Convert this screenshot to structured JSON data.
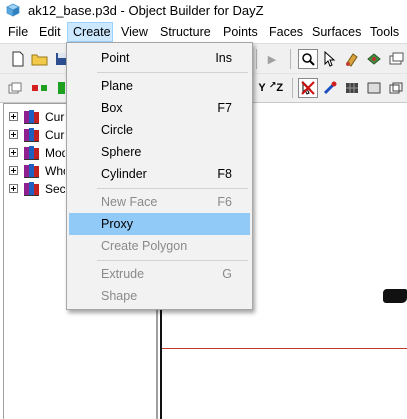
{
  "window": {
    "title": "ak12_base.p3d - Object Builder for DayZ",
    "icon": "cube-icon"
  },
  "menubar": {
    "items": [
      {
        "label": "File"
      },
      {
        "label": "Edit"
      },
      {
        "label": "Create",
        "active": true
      },
      {
        "label": "View"
      },
      {
        "label": "Structure"
      },
      {
        "label": "Points"
      },
      {
        "label": "Faces"
      },
      {
        "label": "Surfaces"
      },
      {
        "label": "Tools"
      }
    ]
  },
  "create_menu": {
    "items": [
      {
        "label": "Point",
        "shortcut": "Ins",
        "enabled": true
      },
      {
        "label": "Plane",
        "shortcut": "",
        "enabled": true
      },
      {
        "label": "Box",
        "shortcut": "F7",
        "enabled": true
      },
      {
        "label": "Circle",
        "shortcut": "",
        "enabled": true
      },
      {
        "label": "Sphere",
        "shortcut": "",
        "enabled": true
      },
      {
        "label": "Cylinder",
        "shortcut": "F8",
        "enabled": true
      },
      {
        "label": "New Face",
        "shortcut": "F6",
        "enabled": false
      },
      {
        "label": "Proxy",
        "shortcut": "",
        "enabled": true,
        "highlighted": true
      },
      {
        "label": "Create Polygon",
        "shortcut": "",
        "enabled": false
      },
      {
        "label": "Extrude",
        "shortcut": "G",
        "enabled": false
      },
      {
        "label": "Shape",
        "shortcut": "",
        "enabled": false
      }
    ]
  },
  "tree": {
    "items": [
      {
        "label": "Curr"
      },
      {
        "label": "Curr"
      },
      {
        "label": "Mode"
      },
      {
        "label": "Who"
      },
      {
        "label": "Secti"
      }
    ]
  },
  "colors": {
    "menu_highlight": "#91c9f7",
    "active_menu": "#cce8ff",
    "viewport_line": "#c0392b"
  }
}
